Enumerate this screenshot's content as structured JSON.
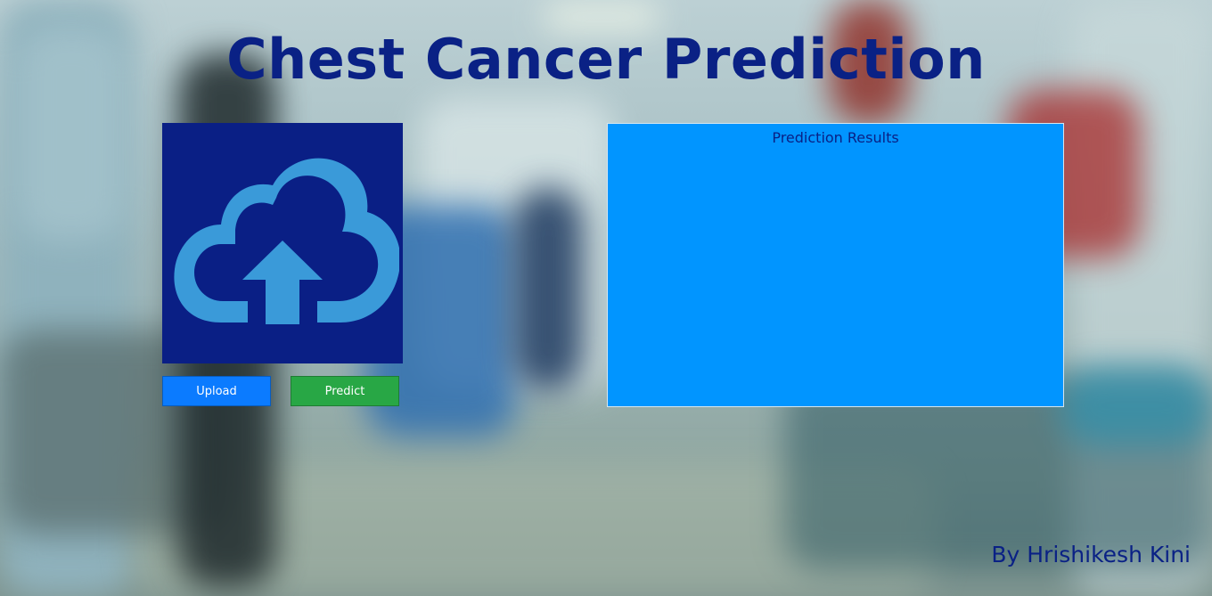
{
  "header": {
    "title": "Chest Cancer Prediction"
  },
  "upload_panel": {
    "icon": "cloud-upload-icon",
    "colors": {
      "panel_bg": "#0a1f85",
      "icon": "#3a9ad9"
    }
  },
  "buttons": {
    "upload_label": "Upload",
    "predict_label": "Predict",
    "colors": {
      "upload": "#0b7bff",
      "predict": "#28a745"
    }
  },
  "results": {
    "title": "Prediction Results",
    "color": "#0195ff"
  },
  "footer": {
    "author": "By Hrishikesh Kini"
  },
  "colors": {
    "title_text": "#0a2185"
  }
}
